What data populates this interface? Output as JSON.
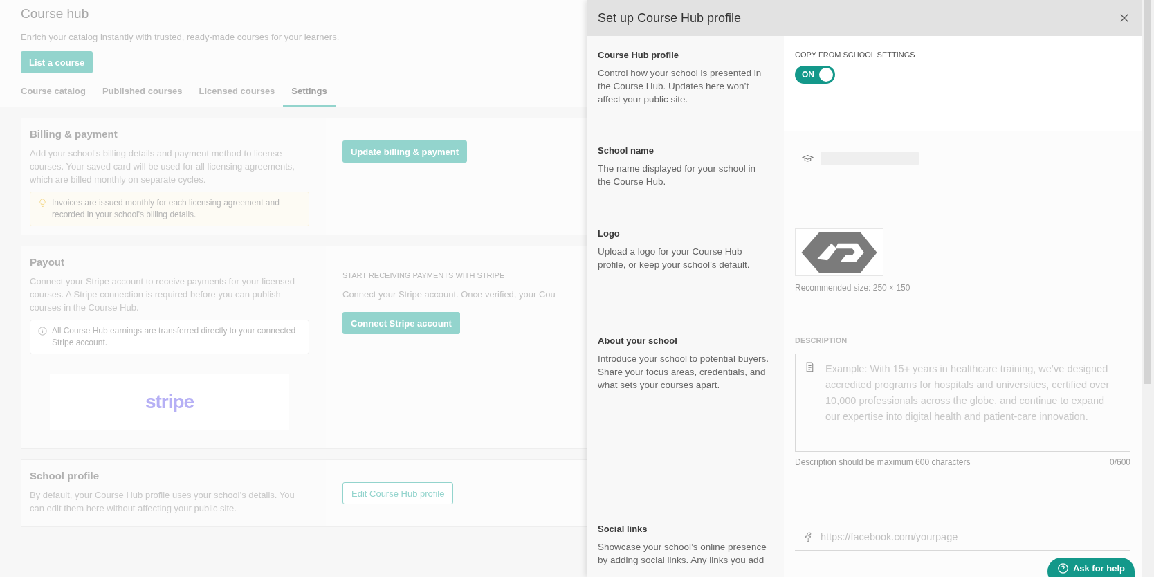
{
  "page": {
    "title": "Course hub",
    "subtitle": "Enrich your catalog instantly with trusted, ready-made courses for your learners.",
    "primary_button": "List a course",
    "tabs": [
      {
        "label": "Course catalog",
        "selected": false
      },
      {
        "label": "Published courses",
        "selected": false
      },
      {
        "label": "Licensed courses",
        "selected": false
      },
      {
        "label": "Settings",
        "selected": true
      }
    ]
  },
  "sections": [
    {
      "title": "Billing & payment",
      "description": "Add your school's billing details and payment method to license courses. Your saved card will be used for all licensing agreements, which are billed monthly on separate cycles.",
      "note": {
        "kind": "tip",
        "text": "Invoices are issued monthly for each licensing agreement and recorded in your school's billing details."
      },
      "action": {
        "kind": "filled",
        "label": "Update billing & payment"
      }
    },
    {
      "title": "Payout",
      "description": "Connect your Stripe account to receive payments for your licensed courses. A Stripe connection is required before you can publish courses in the Course Hub.",
      "note": {
        "kind": "info",
        "text": "All Course Hub earnings are transferred directly to your connected Stripe account."
      },
      "logo": "stripe",
      "eyebrow": "START RECEIVING PAYMENTS WITH STRIPE",
      "body": "Connect your Stripe account. Once verified, your Cou",
      "action": {
        "kind": "filled",
        "label": "Connect Stripe account"
      }
    },
    {
      "title": "School profile",
      "description": "By default, your Course Hub profile uses your school’s details. You can edit them here without affecting your public site.",
      "action": {
        "kind": "outline",
        "label": "Edit Course Hub profile"
      }
    }
  ],
  "panel": {
    "title": "Set up Course Hub profile",
    "rows": [
      {
        "kind": "toggle",
        "title": "Course Hub profile",
        "description": "Control how your school is presented in the Course Hub. Updates here won’t affect your public site.",
        "label": "COPY FROM SCHOOL SETTINGS",
        "on": true,
        "toggle_text": "ON"
      },
      {
        "kind": "text_input",
        "title": "School name",
        "description": "The name displayed for your school in the Course Hub."
      },
      {
        "kind": "logo",
        "title": "Logo",
        "description": "Upload a logo for your Course Hub profile, or keep your school’s default.",
        "hint": "Recommended size: 250 × 150"
      },
      {
        "kind": "textarea",
        "title": "About your school",
        "description": "Introduce your school to potential buyers. Share your focus areas, credentials, and what sets your courses apart.",
        "label": "DESCRIPTION",
        "placeholder": "Example: With 15+ years in healthcare training, we’ve designed accredited programs for hospitals and universities, certified over 10,000 professionals across the globe, and continue to expand our expertise into digital health and patient-care innovation.",
        "helper": "Description should be maximum 600 characters",
        "counter": "0/600"
      },
      {
        "kind": "social",
        "title": "Social links",
        "description": "Showcase your school’s online presence by adding social links. Any links you add",
        "placeholder": "https://facebook.com/yourpage"
      }
    ]
  },
  "help_button": "Ask for help"
}
